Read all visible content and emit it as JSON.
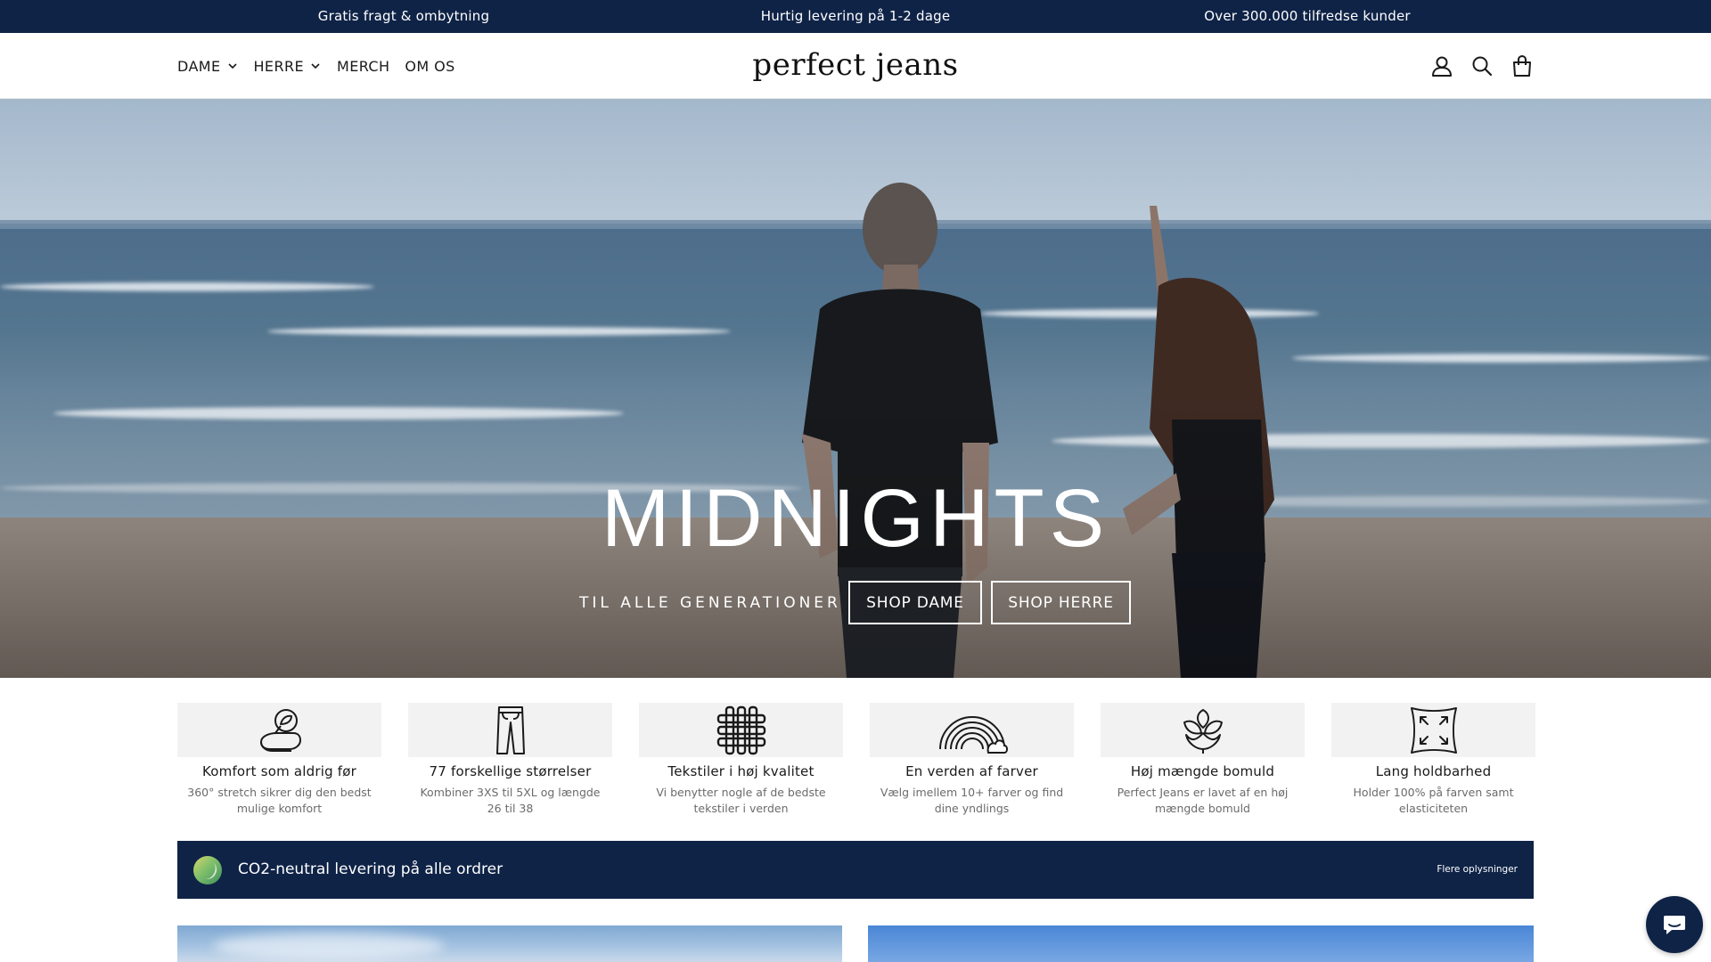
{
  "announcement": {
    "items": [
      "Gratis fragt & ombytning",
      "Hurtig levering på 1-2 dage",
      "Over 300.000 tilfredse kunder"
    ]
  },
  "header": {
    "logo": "perfect jeans",
    "nav": [
      {
        "label": "DAME",
        "has_dropdown": true
      },
      {
        "label": "HERRE",
        "has_dropdown": true
      },
      {
        "label": "MERCH",
        "has_dropdown": false
      },
      {
        "label": "OM OS",
        "has_dropdown": false
      }
    ],
    "icons": [
      "user-icon",
      "search-icon",
      "cart-icon"
    ]
  },
  "hero": {
    "title": "MIDNIGHTS",
    "subtitle": "TIL ALLE GENERATIONER",
    "buttons": [
      "SHOP DAME",
      "SHOP HERRE"
    ]
  },
  "features": [
    {
      "icon": "fabric-roll-icon",
      "title": "Komfort som aldrig før",
      "desc": "360° stretch sikrer dig den bedst mulige komfort"
    },
    {
      "icon": "jeans-icon",
      "title": "77 forskellige størrelser",
      "desc": "Kombiner 3XS til 5XL og længde 26 til 38"
    },
    {
      "icon": "weave-icon",
      "title": "Tekstiler i høj kvalitet",
      "desc": "Vi benytter nogle af de bedste tekstiler i verden"
    },
    {
      "icon": "rainbow-icon",
      "title": "En verden af farver",
      "desc": "Vælg imellem 10+ farver og find dine yndlings"
    },
    {
      "icon": "cotton-icon",
      "title": "Høj mængde bomuld",
      "desc": "Perfect Jeans er lavet af en høj mængde bomuld"
    },
    {
      "icon": "stretch-icon",
      "title": "Lang holdbarhed",
      "desc": "Holder 100% på farven samt elasticiteten"
    }
  ],
  "co2_banner": {
    "text": "CO2-neutral levering på alle ordrer",
    "link": "Flere oplysninger"
  },
  "colors": {
    "navy": "#0f2347",
    "feature_bg": "#f2f2f2"
  }
}
